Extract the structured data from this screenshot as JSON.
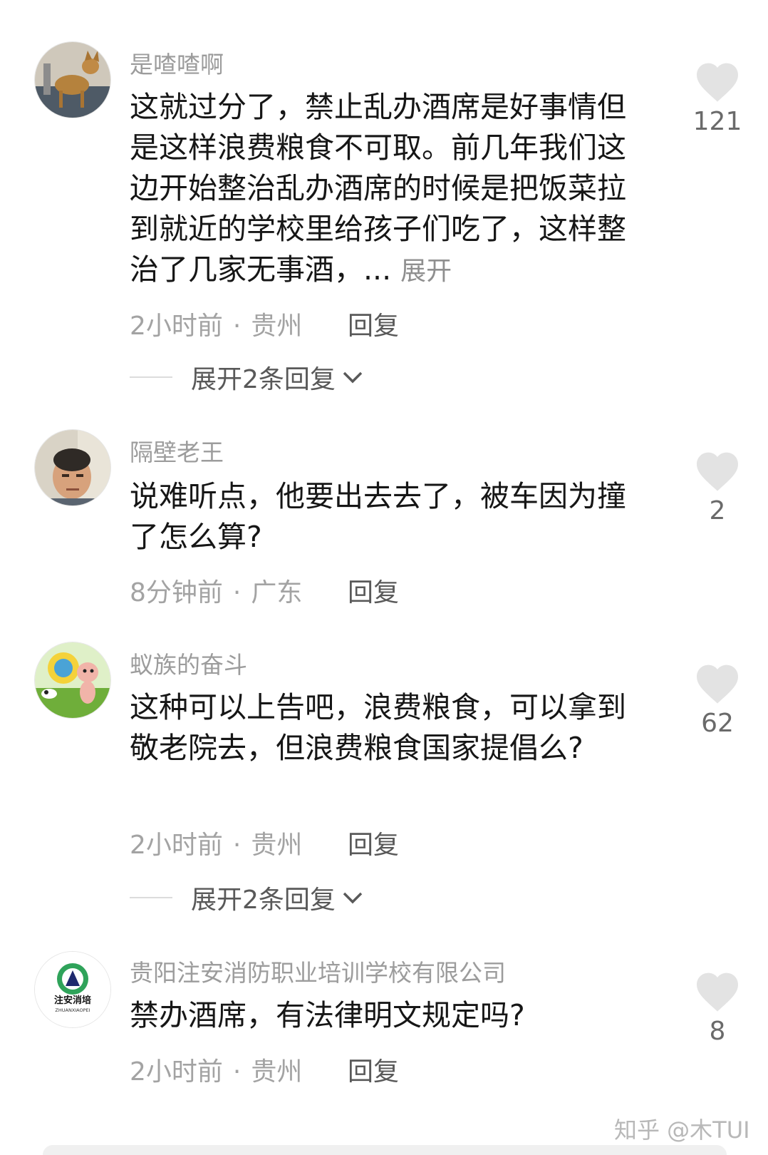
{
  "comments": [
    {
      "username": "是喳喳啊",
      "text": "这就过分了，禁止乱办酒席是好事情但是这样浪费粮食不可取。前几年我们这边开始整治乱办酒席的时候是把饭菜拉到就近的学校里给孩子们吃了，这样整治了几家无事酒，...",
      "expand_label": "展开",
      "time": "2小时前",
      "location": "贵州",
      "reply_label": "回复",
      "expand_replies": "展开2条回复",
      "likes": "121"
    },
    {
      "username": "隔壁老王",
      "text": "说难听点，他要出去去了，被车因为撞了怎么算?",
      "time": "8分钟前",
      "location": "广东",
      "reply_label": "回复",
      "likes": "2"
    },
    {
      "username": "蚁族的奋斗",
      "text": "这种可以上告吧，浪费粮食，可以拿到敬老院去，但浪费粮食国家提倡么?",
      "time": "2小时前",
      "location": "贵州",
      "reply_label": "回复",
      "expand_replies": "展开2条回复",
      "likes": "62"
    },
    {
      "username": "贵阳注安消防职业培训学校有限公司",
      "text": "禁办酒席，有法律明文规定吗?",
      "time": "2小时前",
      "location": "贵州",
      "reply_label": "回复",
      "likes": "8",
      "avatar_logo_text": "注安消培",
      "avatar_logo_subtext": "ZHUANXIAOPEI"
    }
  ],
  "separator": "·",
  "watermark": "知乎 @木TUI",
  "colors": {
    "username": "#9c9c9c",
    "text": "#161616",
    "meta": "#a3a3a3",
    "heart": "#e3e3e3"
  }
}
